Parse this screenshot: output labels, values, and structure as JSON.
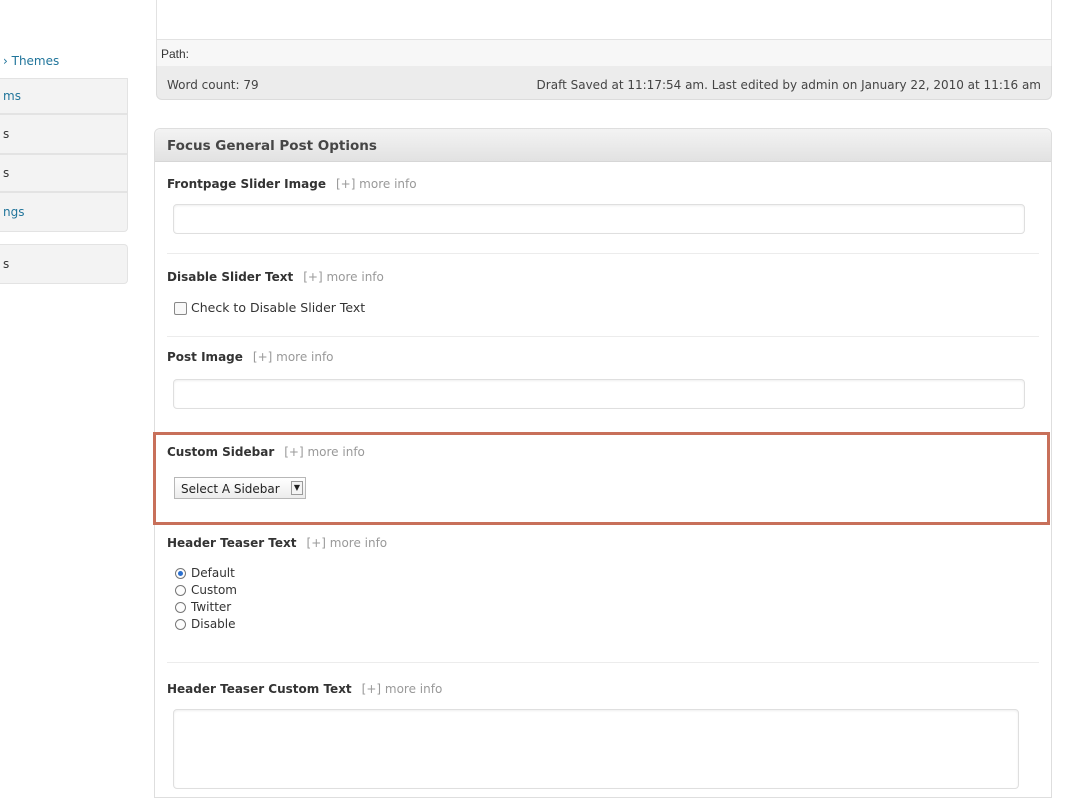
{
  "sidebar": {
    "items": [
      {
        "label": "› Themes"
      },
      {
        "label": "ms"
      },
      {
        "label": "s"
      },
      {
        "label": "s"
      },
      {
        "label": "ngs"
      },
      {
        "label": "s"
      }
    ]
  },
  "editor": {
    "path_label": "Path:",
    "word_count": "Word count: 79",
    "draft_status": "Draft Saved at 11:17:54 am. Last edited by admin on January 22, 2010 at 11:16 am"
  },
  "panel": {
    "title": "Focus General Post Options",
    "more_info": "[+] more info",
    "frontpage_slider": {
      "label": "Frontpage Slider Image",
      "value": ""
    },
    "disable_slider": {
      "label": "Disable Slider Text",
      "checkbox_label": "Check to Disable Slider Text",
      "checked": false
    },
    "post_image": {
      "label": "Post Image",
      "value": ""
    },
    "custom_sidebar": {
      "label": "Custom Sidebar",
      "selected": "Select A Sidebar"
    },
    "header_teaser": {
      "label": "Header Teaser Text",
      "options": [
        {
          "label": "Default",
          "checked": true
        },
        {
          "label": "Custom",
          "checked": false
        },
        {
          "label": "Twitter",
          "checked": false
        },
        {
          "label": "Disable",
          "checked": false
        }
      ]
    },
    "header_teaser_custom": {
      "label": "Header Teaser Custom Text",
      "value": ""
    }
  },
  "colors": {
    "link": "#21759b",
    "highlight_border": "#c8705a",
    "radio_selected": "#2a6fcf"
  }
}
